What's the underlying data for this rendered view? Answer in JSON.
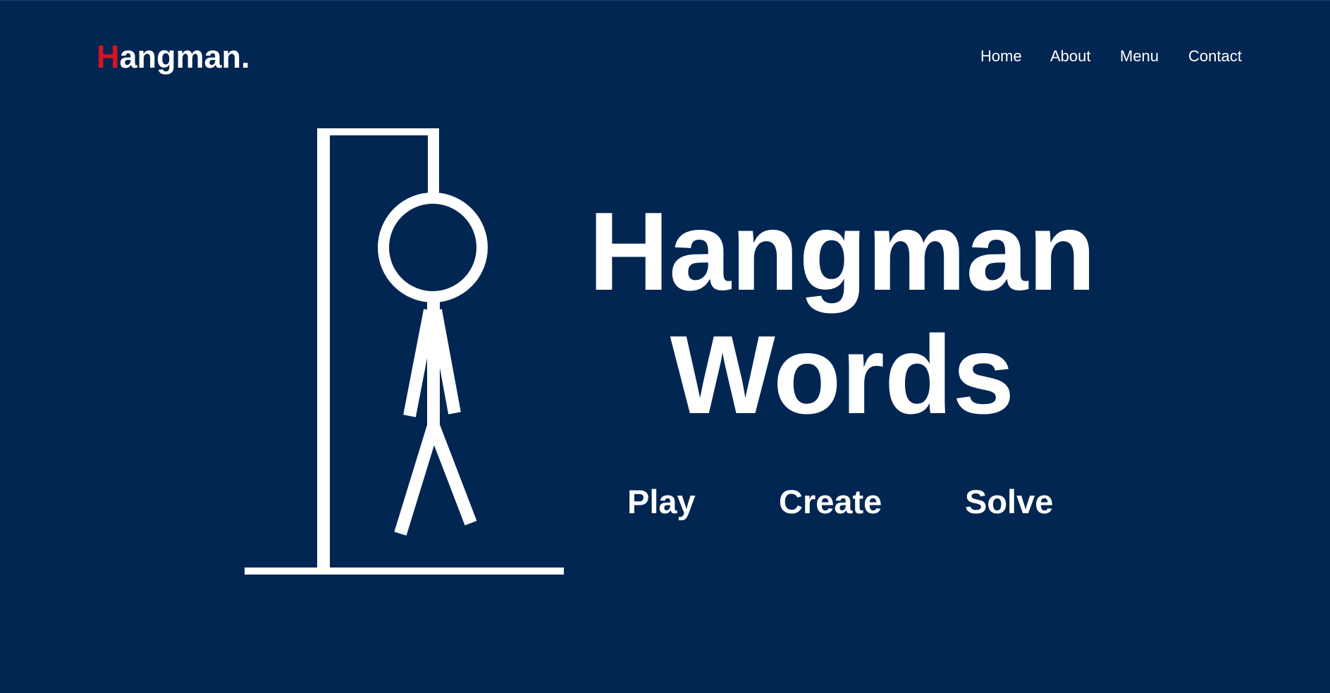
{
  "header": {
    "logo_first_letter": "H",
    "logo_rest": "angman.",
    "nav": [
      {
        "label": "Home"
      },
      {
        "label": "About"
      },
      {
        "label": "Menu"
      },
      {
        "label": "Contact"
      }
    ]
  },
  "hero": {
    "title_line1": "Hangman",
    "title_line2": "Words",
    "actions": [
      {
        "label": "Play"
      },
      {
        "label": "Create"
      },
      {
        "label": "Solve"
      }
    ]
  },
  "colors": {
    "background": "#002651",
    "text": "#ffffff",
    "logo_accent": "#d8141f"
  },
  "icons": {
    "illustration": "hangman-gallows-icon"
  }
}
